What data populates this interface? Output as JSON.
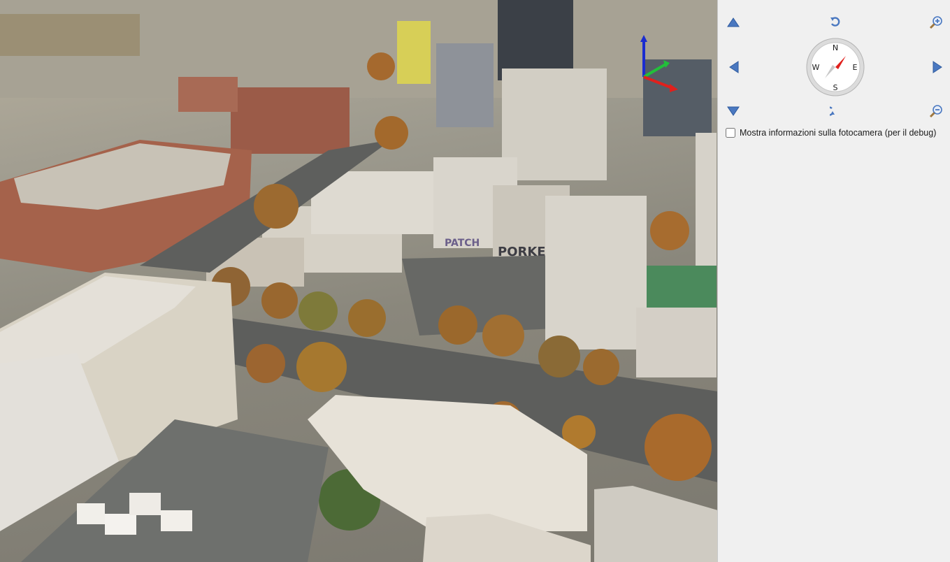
{
  "viewport": {
    "description_icon": "3d-map-icon",
    "axis_colors": {
      "x": "#e0201c",
      "y": "#22c03a",
      "z": "#1a2cd0"
    },
    "graffiti": [
      "PATCH",
      "PORKE"
    ]
  },
  "navigation": {
    "accent_color": "#4a78c0",
    "tilt_up_icon": "triangle-up-icon",
    "tilt_down_icon": "triangle-down-icon",
    "pan_left_icon": "triangle-left-icon",
    "pan_right_icon": "triangle-right-icon",
    "rotate_ccw_icon": "rotate-ccw-icon",
    "rotate_cw_icon": "rotate-cw-icon",
    "zoom_in_icon": "zoom-in-icon",
    "zoom_out_icon": "zoom-out-icon"
  },
  "compass": {
    "north": "N",
    "south": "S",
    "east": "E",
    "west": "W",
    "needle_north_color": "#e0201c"
  },
  "debug": {
    "label": "Mostra informazioni sulla fotocamera (per il debug)",
    "checked": false
  }
}
